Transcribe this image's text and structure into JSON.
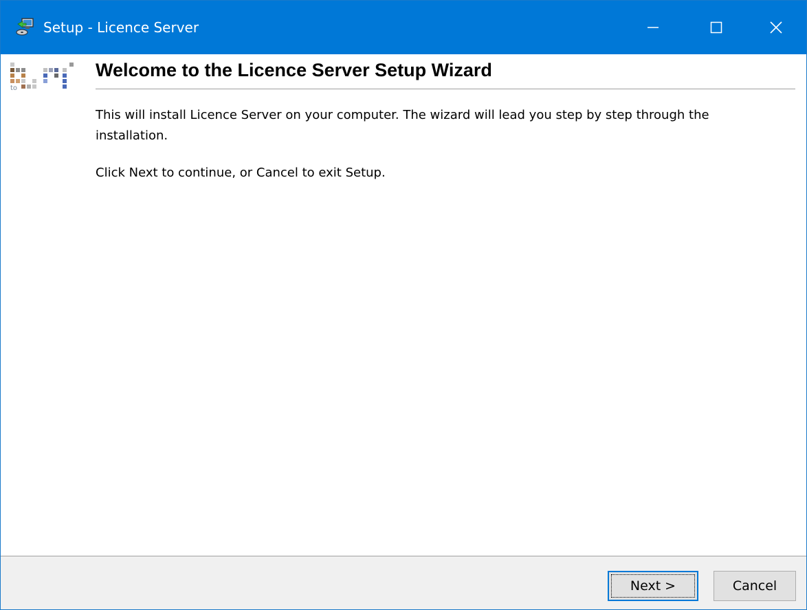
{
  "window": {
    "title": "Setup - Licence Server",
    "icon": "computer-install-icon",
    "controls": {
      "minimize_icon": "minimize-icon",
      "maximize_icon": "maximize-icon",
      "close_icon": "close-icon"
    },
    "accent_color": "#0078d7"
  },
  "header": {
    "logo": "company-logo",
    "logo_text": "to",
    "title": "Welcome to the Licence Server Setup Wizard"
  },
  "main": {
    "paragraph1": "This will install Licence Server on your computer. The wizard will lead you step by step through the installation.",
    "paragraph2": "Click Next to continue, or Cancel to exit Setup."
  },
  "footer": {
    "next_label": "Next >",
    "cancel_label": "Cancel"
  }
}
